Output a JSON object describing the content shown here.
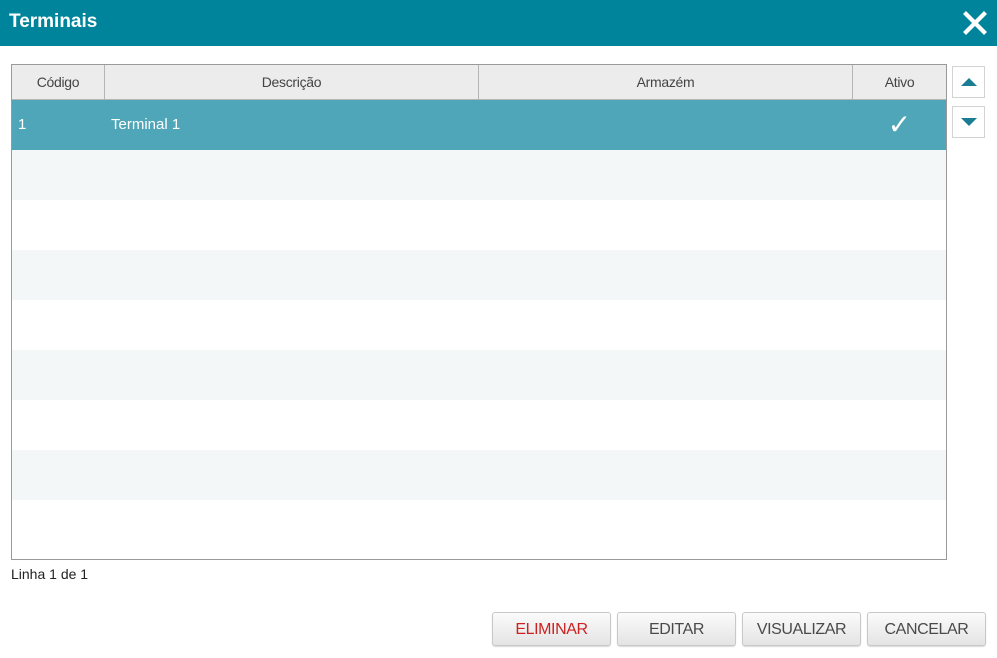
{
  "dialog": {
    "title": "Terminais",
    "close_icon": "close-icon"
  },
  "table": {
    "columns": [
      "Código",
      "Descrição",
      "Armazém",
      "Ativo"
    ],
    "rows": [
      {
        "codigo": "1",
        "descricao": "Terminal 1",
        "armazem": "",
        "ativo": "✓",
        "selected": true
      }
    ],
    "empty_rows": 8
  },
  "scroll": {
    "up_icon": "triangle-up-icon",
    "down_icon": "triangle-down-icon"
  },
  "status": {
    "text": "Linha 1 de 1"
  },
  "buttons": {
    "delete": "ELIMINAR",
    "edit": "EDITAR",
    "view": "VISUALIZAR",
    "cancel": "CANCELAR"
  },
  "colors": {
    "titlebar": "#00849b",
    "selected_row": "#4ea6b8",
    "delete_text": "#cc2222",
    "scroll_arrow": "#1a7d93"
  }
}
